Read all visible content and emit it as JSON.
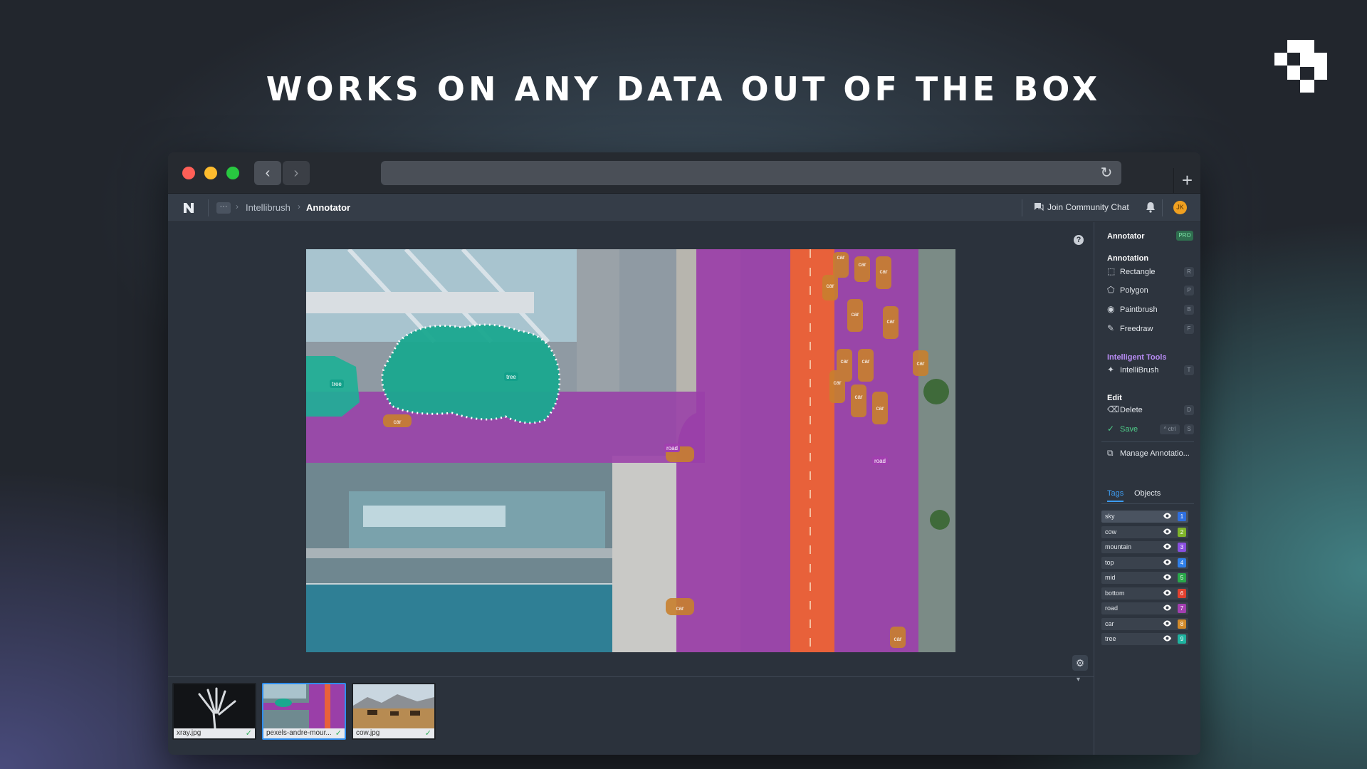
{
  "headline": "WORKS ON ANY DATA OUT OF THE BOX",
  "appbar": {
    "breadcrumb_more": "···",
    "breadcrumb_parent": "Intellibrush",
    "breadcrumb_current": "Annotator",
    "join_chat": "Join Community Chat",
    "avatar_initials": "JK"
  },
  "sidebar": {
    "title": "Annotator",
    "badge": "PRO",
    "annotation_header": "Annotation",
    "tools": [
      {
        "label": "Rectangle",
        "key": "R"
      },
      {
        "label": "Polygon",
        "key": "P"
      },
      {
        "label": "Paintbrush",
        "key": "B"
      },
      {
        "label": "Freedraw",
        "key": "F"
      }
    ],
    "intelligent_header": "Intelligent Tools",
    "intellibrush": {
      "label": "IntelliBrush",
      "key": "T"
    },
    "edit_header": "Edit",
    "delete": {
      "label": "Delete",
      "key": "D"
    },
    "save": {
      "label": "Save",
      "ctrl": "^ ctrl",
      "key": "S"
    },
    "manage": "Manage Annotatio...",
    "tabs": {
      "tags": "Tags",
      "objects": "Objects"
    },
    "tags": [
      {
        "name": "sky",
        "num": "1",
        "color": "#2f6fe0"
      },
      {
        "name": "cow",
        "num": "2",
        "color": "#7fb52a"
      },
      {
        "name": "mountain",
        "num": "3",
        "color": "#8a4fe0"
      },
      {
        "name": "top",
        "num": "4",
        "color": "#2f7fe8"
      },
      {
        "name": "mid",
        "num": "5",
        "color": "#2aa84a"
      },
      {
        "name": "bottom",
        "num": "6",
        "color": "#e0402f"
      },
      {
        "name": "road",
        "num": "7",
        "color": "#a23fb0"
      },
      {
        "name": "car",
        "num": "8",
        "color": "#d28a2a"
      },
      {
        "name": "tree",
        "num": "9",
        "color": "#1fb3a0"
      }
    ]
  },
  "canvas": {
    "labels": {
      "tree": "tree",
      "car": "car",
      "road": "road"
    }
  },
  "filmstrip": [
    {
      "name": "xray.jpg",
      "selected": false
    },
    {
      "name": "pexels-andre-mour...",
      "selected": true
    },
    {
      "name": "cow.jpg",
      "selected": false
    }
  ],
  "colors": {
    "accent": "#2f8ded",
    "save_green": "#4fd08a",
    "intelligent_purple": "#b98cf5"
  }
}
